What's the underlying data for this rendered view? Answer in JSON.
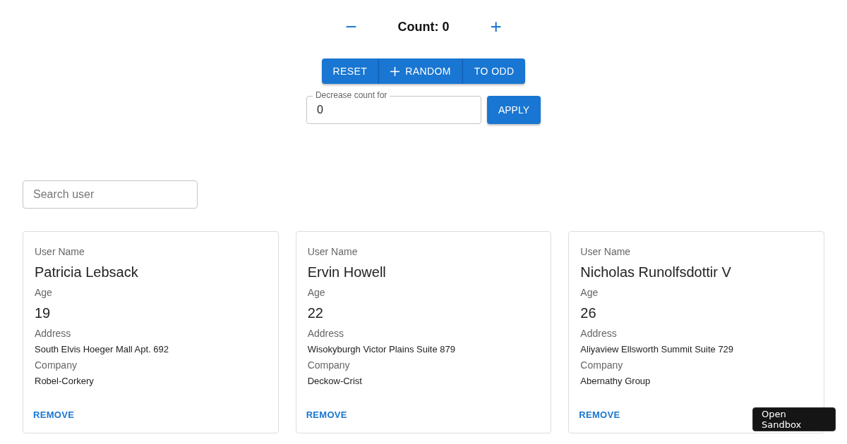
{
  "counter": {
    "decrement": "−",
    "label": "Count: 0",
    "increment": "+"
  },
  "button_group": [
    {
      "kind": "text",
      "label": "RESET"
    },
    {
      "kind": "plus",
      "label": "RANDOM"
    },
    {
      "kind": "text",
      "label": "TO ODD"
    }
  ],
  "decrease_field": {
    "label": "Decrease count for",
    "value": "0"
  },
  "apply_button": "APPLY",
  "search": {
    "placeholder": "Search user"
  },
  "cards": [
    {
      "fields": [
        {
          "kind": "large",
          "label": "User Name",
          "value": "Patricia Lebsack"
        },
        {
          "kind": "large",
          "label": "Age",
          "value": "19"
        },
        {
          "kind": "small",
          "label": "Address",
          "value": "South Elvis Hoeger Mall Apt. 692"
        },
        {
          "kind": "small",
          "label": "Company",
          "value": "Robel-Corkery"
        }
      ],
      "action": "REMOVE"
    },
    {
      "fields": [
        {
          "kind": "large",
          "label": "User Name",
          "value": "Ervin Howell"
        },
        {
          "kind": "large",
          "label": "Age",
          "value": "22"
        },
        {
          "kind": "small",
          "label": "Address",
          "value": "Wisokyburgh Victor Plains Suite 879"
        },
        {
          "kind": "small",
          "label": "Company",
          "value": "Deckow-Crist"
        }
      ],
      "action": "REMOVE"
    },
    {
      "fields": [
        {
          "kind": "large",
          "label": "User Name",
          "value": "Nicholas Runolfsdottir V"
        },
        {
          "kind": "large",
          "label": "Age",
          "value": "26"
        },
        {
          "kind": "small",
          "label": "Address",
          "value": "Aliyaview Ellsworth Summit Suite 729"
        },
        {
          "kind": "small",
          "label": "Company",
          "value": "Abernathy Group"
        }
      ],
      "action": "REMOVE"
    }
  ],
  "sandbox_button": "Open Sandbox"
}
